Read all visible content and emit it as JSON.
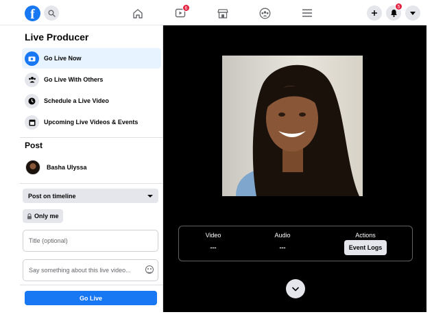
{
  "topbar": {
    "logo_letter": "f",
    "badges": {
      "watch": "6",
      "notifications": "5"
    }
  },
  "sidebar": {
    "title": "Live Producer",
    "items": [
      {
        "label": "Go Live Now",
        "icon": "camera-icon",
        "active": true
      },
      {
        "label": "Go Live With Others",
        "icon": "group-icon",
        "active": false
      },
      {
        "label": "Schedule a Live Video",
        "icon": "clock-icon",
        "active": false
      },
      {
        "label": "Upcoming Live Videos & Events",
        "icon": "calendar-icon",
        "active": false
      }
    ],
    "post_title": "Post",
    "profile_name": "Basha Ulyssa",
    "post_location": "Post on timeline",
    "privacy": "Only me",
    "title_placeholder": "Title (optional)",
    "description_placeholder": "Say something about this live video...",
    "go_live_label": "Go Live"
  },
  "stage": {
    "video_label": "Video",
    "video_value": "---",
    "audio_label": "Audio",
    "audio_value": "---",
    "actions_label": "Actions",
    "event_logs_label": "Event Logs"
  },
  "colors": {
    "accent": "#1877f2",
    "stage_bg": "#000000",
    "badge": "#e41e3f"
  }
}
